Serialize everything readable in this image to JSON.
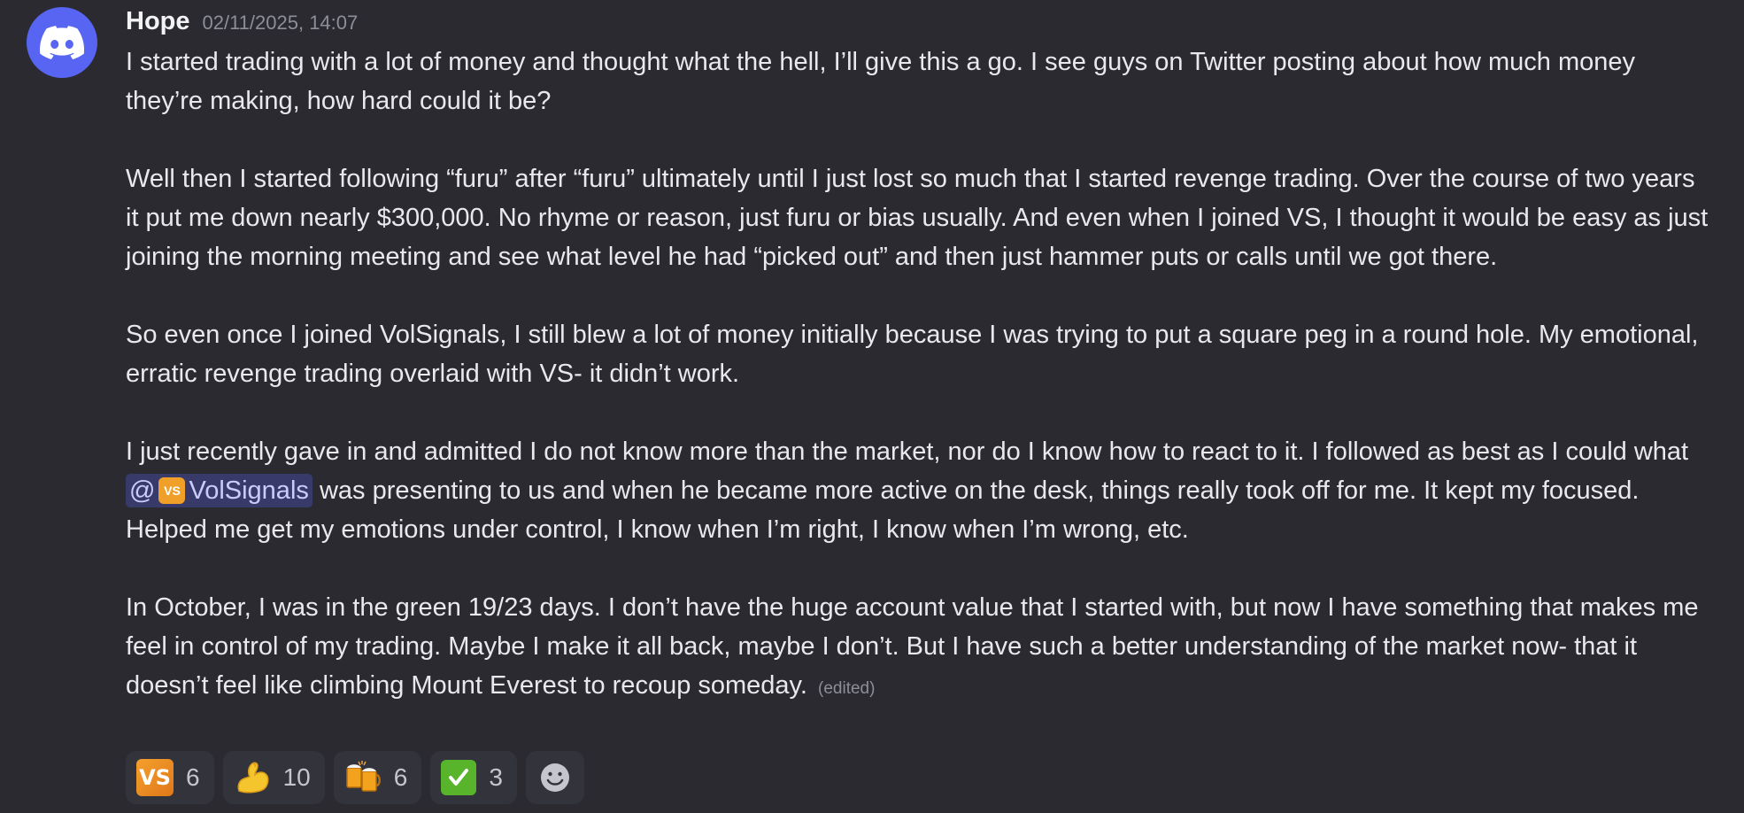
{
  "message": {
    "author": "Hope",
    "timestamp": "02/11/2025, 14:07",
    "paragraphs": {
      "p1": "I started trading with a lot of money and thought what the hell, I’ll give this a go. I see guys on Twitter posting about how much money they’re making, how hard could it be?",
      "p2": "Well then I started following “furu” after “furu” ultimately until I just lost so much that I started revenge trading. Over the course of two years it put me down nearly $300,000. No rhyme or reason, just furu or bias usually. And even when I joined VS, I thought it would be easy as just joining the morning meeting and see what level he had “picked out” and then just hammer puts or calls until we got there.",
      "p3": "So even once I joined VolSignals, I still blew a lot of money initially because I was trying to put a square peg in a round hole. My emotional, erratic revenge trading overlaid with VS- it didn’t work.",
      "p4_before": "I just recently gave in and admitted I do not know more than the market, nor do I know how to react to it. I followed as best as I could what ",
      "p4_after": " was presenting to us and when he became more active on the desk, things really took off for me. It kept my focused. Helped me get my emotions under control, I know when I’m right, I know when I’m wrong, etc.",
      "p5": "In October, I was in the green 19/23 days. I don’t have the huge account value that I started with, but now I have something that makes me feel in control of my trading. Maybe I make it all back, maybe I don’t. But I have such a better understanding of the market now- that it doesn’t feel like climbing Mount Everest to recoup someday."
    },
    "mention": {
      "at": "@",
      "badge": "VS",
      "name": "VolSignals"
    },
    "edited_label": "(edited)"
  },
  "reactions": [
    {
      "emoji": "vs-badge-icon",
      "badge_text": "VS",
      "count": "6"
    },
    {
      "emoji": "flexed-biceps-icon",
      "count": "10"
    },
    {
      "emoji": "clinking-beer-mugs-icon",
      "count": "6"
    },
    {
      "emoji": "check-mark-button-icon",
      "count": "3"
    }
  ],
  "add_reaction_icon": "smiley-add-reaction-icon",
  "colors": {
    "background": "#2a2a30",
    "avatar": "#5865f2",
    "mention_bg": "rgba(88,101,242,0.3)",
    "mention_text": "#c9cdfb",
    "reaction_bg": "#33343b"
  }
}
